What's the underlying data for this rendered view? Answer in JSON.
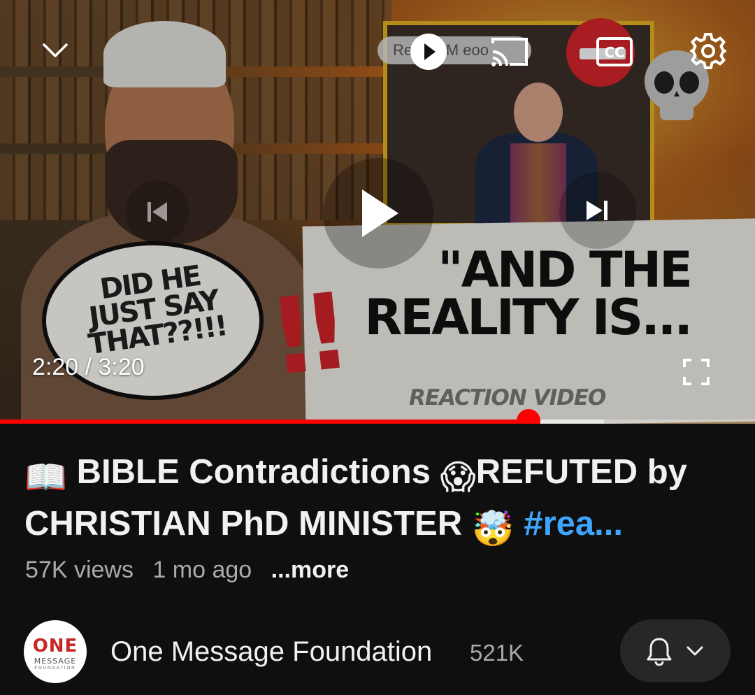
{
  "player": {
    "thumbnail": {
      "bubble_text": "DID HE JUST SAY THAT??!!!",
      "exclaim": "!!",
      "headline": "\"AND THE REALITY IS...",
      "subtitle": "REACTION VIDEO",
      "pill_text": "Re     ace M    eoo"
    },
    "time_display": "2:20 / 3:20",
    "progress_fraction": 0.7,
    "buffered_fraction": 0.8,
    "icons": {
      "collapse": "chevron-down-icon",
      "autoplay": "play-circle-icon",
      "cast": "cast-icon",
      "captions": "cc-icon",
      "settings": "gear-icon",
      "previous": "skip-previous-icon",
      "play": "play-icon",
      "next": "skip-next-icon",
      "fullscreen": "fullscreen-icon"
    },
    "accent_color": "#ff0000"
  },
  "video": {
    "title_emoji_1": "📖",
    "title_part_1": " BIBLE Contradictions ",
    "title_emoji_2": "😱",
    "title_part_2": "REFUTED by CHRISTIAN PhD MINISTER ",
    "title_emoji_3": "🤯",
    "title_hashtag": " #rea...",
    "views": "57K views",
    "age": "1 mo ago",
    "more_label": "...more"
  },
  "channel": {
    "avatar_text_1": "ONE",
    "avatar_text_2": "MESSAGE",
    "avatar_text_3": "FOUNDATION",
    "name": "One Message Foundation",
    "subscribers": "521K",
    "subscribe_icons": [
      "bell-icon",
      "chevron-down-icon"
    ]
  }
}
